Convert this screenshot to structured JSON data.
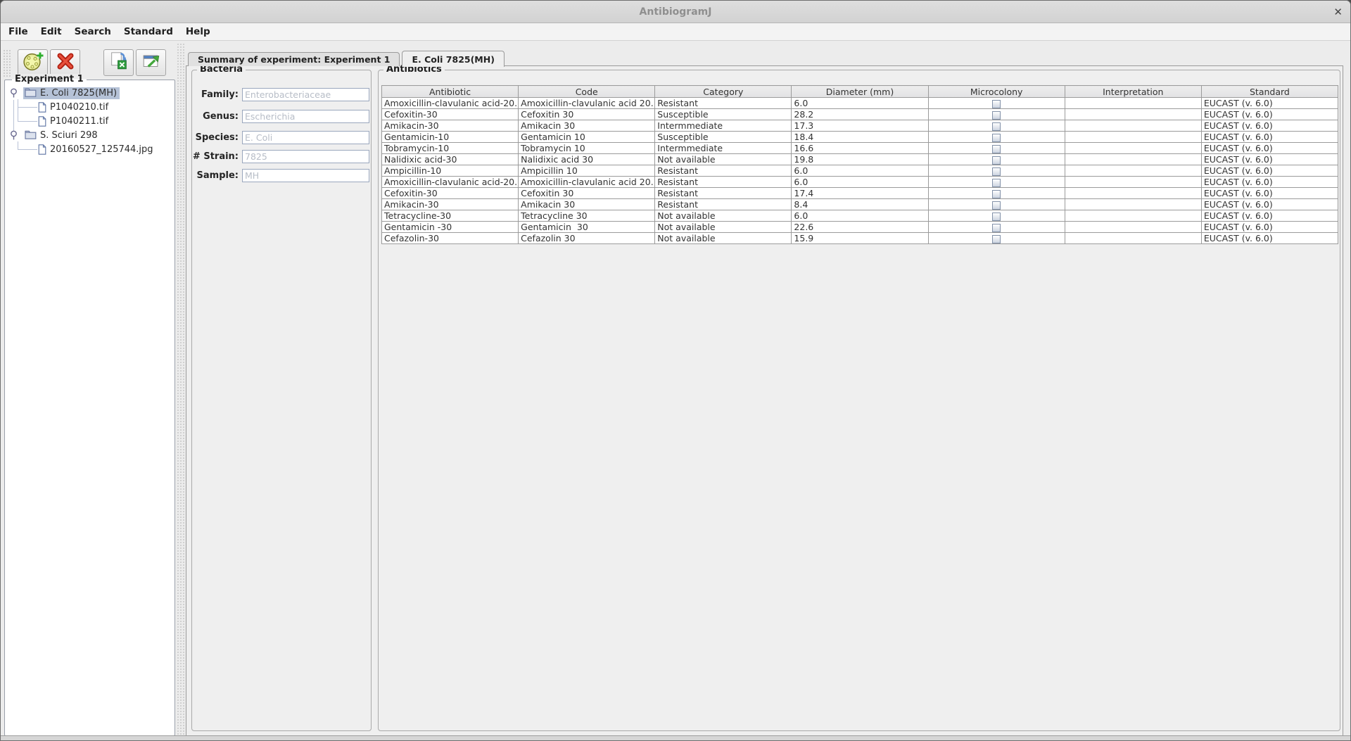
{
  "window": {
    "title": "AntibiogramJ",
    "close_label": "✕"
  },
  "menu": {
    "items": [
      "File",
      "Edit",
      "Search",
      "Standard",
      "Help"
    ]
  },
  "toolbar": {
    "buttons": [
      {
        "name": "new-experiment",
        "icon": "petri-dish-add-icon"
      },
      {
        "name": "delete",
        "icon": "red-x-icon"
      },
      {
        "name": "export-excel",
        "icon": "excel-export-icon"
      },
      {
        "name": "export-window",
        "icon": "window-export-icon"
      }
    ]
  },
  "sidebar": {
    "group_title": "Experiment 1",
    "tree": [
      {
        "label": "E. Coli 7825(MH)",
        "type": "folder",
        "selected": true,
        "children": [
          {
            "label": "P1040210.tif",
            "type": "file"
          },
          {
            "label": "P1040211.tif",
            "type": "file"
          }
        ]
      },
      {
        "label": "S. Sciuri 298",
        "type": "folder",
        "selected": false,
        "children": [
          {
            "label": "20160527_125744.jpg",
            "type": "file"
          }
        ]
      }
    ]
  },
  "tabs": [
    {
      "label": "Summary of experiment: Experiment 1",
      "active": false
    },
    {
      "label": "E. Coli 7825(MH)",
      "active": true
    }
  ],
  "bacteria": {
    "group_title": "Bacteria",
    "fields": [
      {
        "label": "Family:",
        "value": "Enterobacteriaceae"
      },
      {
        "label": "Genus:",
        "value": "Escherichia"
      },
      {
        "label": "Species:",
        "value": "E. Coli"
      },
      {
        "label": "# Strain:",
        "value": "7825"
      },
      {
        "label": "Sample:",
        "value": "MH"
      }
    ]
  },
  "antibiotics": {
    "group_title": "Antibiotics",
    "columns": [
      "Antibiotic",
      "Code",
      "Category",
      "Diameter (mm)",
      "Microcolony",
      "Interpretation",
      "Standard"
    ],
    "rows": [
      {
        "antibiotic": "Amoxicillin-clavulanic acid-20...",
        "code": "Amoxicillin-clavulanic acid 20...",
        "category": "Resistant",
        "diameter": "6.0",
        "microcolony": false,
        "interpretation": "",
        "standard": "EUCAST (v. 6.0)"
      },
      {
        "antibiotic": "Cefoxitin-30",
        "code": "Cefoxitin 30",
        "category": "Susceptible",
        "diameter": "28.2",
        "microcolony": false,
        "interpretation": "",
        "standard": "EUCAST (v. 6.0)"
      },
      {
        "antibiotic": "Amikacin-30",
        "code": "Amikacin 30",
        "category": "Intermmediate",
        "diameter": "17.3",
        "microcolony": false,
        "interpretation": "",
        "standard": "EUCAST (v. 6.0)"
      },
      {
        "antibiotic": "Gentamicin-10",
        "code": "Gentamicin 10",
        "category": "Susceptible",
        "diameter": "18.4",
        "microcolony": false,
        "interpretation": "",
        "standard": "EUCAST (v. 6.0)"
      },
      {
        "antibiotic": "Tobramycin-10",
        "code": "Tobramycin 10",
        "category": "Intermmediate",
        "diameter": "16.6",
        "microcolony": false,
        "interpretation": "",
        "standard": "EUCAST (v. 6.0)"
      },
      {
        "antibiotic": "Nalidixic acid-30",
        "code": "Nalidixic acid 30",
        "category": "Not available",
        "diameter": "19.8",
        "microcolony": false,
        "interpretation": "",
        "standard": "EUCAST (v. 6.0)"
      },
      {
        "antibiotic": "Ampicillin-10",
        "code": "Ampicillin 10",
        "category": "Resistant",
        "diameter": "6.0",
        "microcolony": false,
        "interpretation": "",
        "standard": "EUCAST (v. 6.0)"
      },
      {
        "antibiotic": "Amoxicillin-clavulanic acid-20...",
        "code": "Amoxicillin-clavulanic acid 20...",
        "category": "Resistant",
        "diameter": "6.0",
        "microcolony": false,
        "interpretation": "",
        "standard": "EUCAST (v. 6.0)"
      },
      {
        "antibiotic": "Cefoxitin-30",
        "code": "Cefoxitin 30",
        "category": "Resistant",
        "diameter": "17.4",
        "microcolony": false,
        "interpretation": "",
        "standard": "EUCAST (v. 6.0)"
      },
      {
        "antibiotic": "Amikacin-30",
        "code": "Amikacin 30",
        "category": "Resistant",
        "diameter": "8.4",
        "microcolony": false,
        "interpretation": "",
        "standard": "EUCAST (v. 6.0)"
      },
      {
        "antibiotic": "Tetracycline-30",
        "code": "Tetracycline 30",
        "category": "Not available",
        "diameter": "6.0",
        "microcolony": false,
        "interpretation": "",
        "standard": "EUCAST (v. 6.0)"
      },
      {
        "antibiotic": "Gentamicin -30",
        "code": "Gentamicin  30",
        "category": "Not available",
        "diameter": "22.6",
        "microcolony": false,
        "interpretation": "",
        "standard": "EUCAST (v. 6.0)"
      },
      {
        "antibiotic": "Cefazolin-30",
        "code": "Cefazolin 30",
        "category": "Not available",
        "diameter": "15.9",
        "microcolony": false,
        "interpretation": "",
        "standard": "EUCAST (v. 6.0)"
      }
    ]
  },
  "colors": {
    "selection_highlight": "#b5c2d7",
    "panel_bg": "#efefef",
    "titlebar_bg": "#d7d7d7",
    "table_grid": "#9b9b9b",
    "delete_icon_red": "#c62717",
    "add_icon_green": "#2fae2f"
  }
}
